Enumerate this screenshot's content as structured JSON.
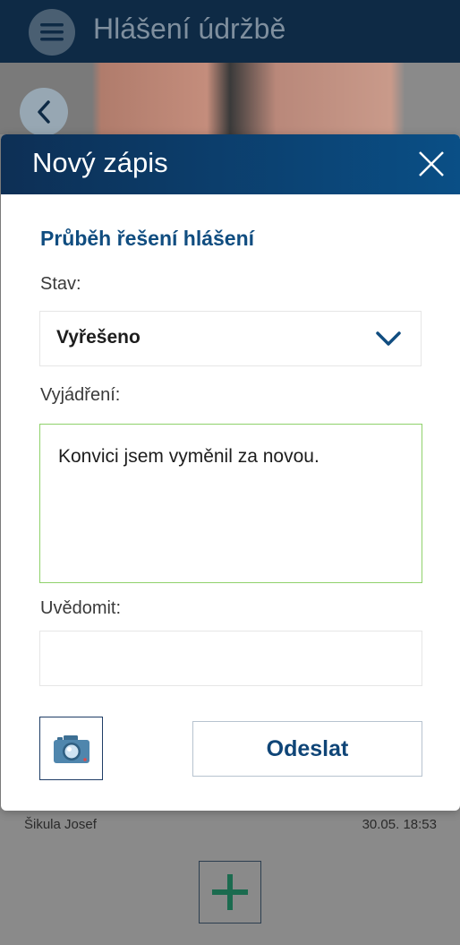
{
  "app": {
    "title": "Hlášení údržbě"
  },
  "background": {
    "author": "Šikula Josef",
    "timestamp": "30.05. 18:53"
  },
  "modal": {
    "title": "Nový zápis",
    "section_title": "Průběh řešení hlášení",
    "status_label": "Stav:",
    "status_value": "Vyřešeno",
    "comment_label": "Vyjádření:",
    "comment_value": "Konvici jsem vyměnil za novou.",
    "notify_label": "Uvědomit:",
    "notify_value": "",
    "send_label": "Odeslat"
  },
  "colors": {
    "header_bg": "#0e2a45",
    "modal_header": "#0b3f70",
    "accent_blue": "#104d80",
    "textarea_focus_border": "#8fd16b",
    "fab_plus": "#1b6b4f"
  },
  "icons": {
    "menu": "hamburger-menu-icon",
    "back": "chevron-left-icon",
    "close": "close-icon",
    "dropdown": "chevron-down-icon",
    "camera": "camera-icon",
    "add": "plus-icon"
  }
}
